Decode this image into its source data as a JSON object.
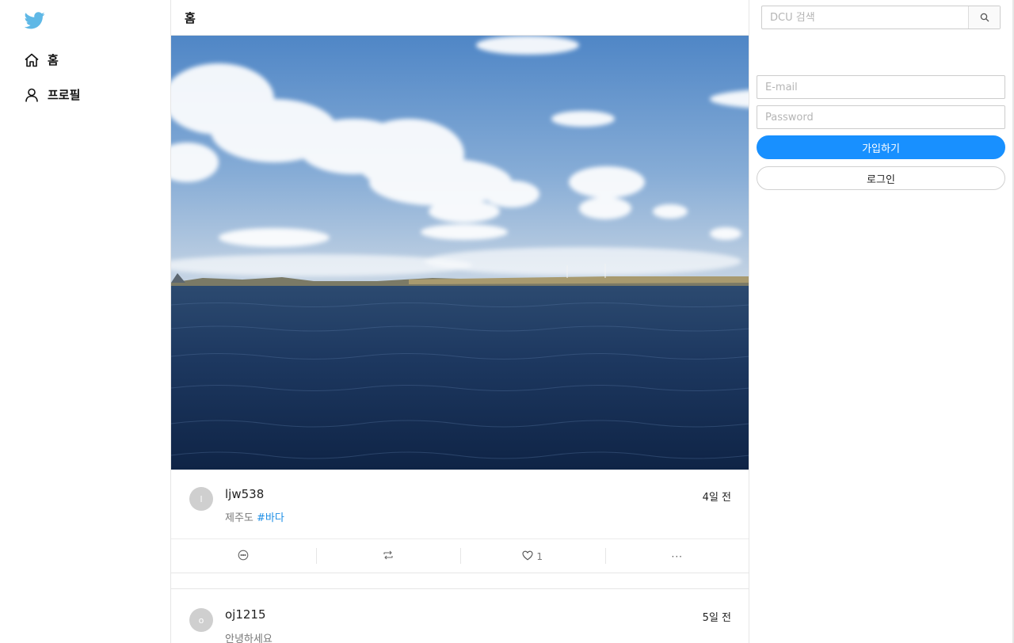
{
  "colors": {
    "brand": "#1d9bf0",
    "accent": "#1890ff",
    "hashtag": "#1d8ee6",
    "border": "#e6e6e6"
  },
  "sidebar": {
    "logo_icon": "bird-icon",
    "items": [
      {
        "label": "홈",
        "icon": "home-icon"
      },
      {
        "label": "프로필",
        "icon": "user-icon"
      }
    ]
  },
  "main": {
    "title": "홈",
    "posts": [
      {
        "avatar_letter": "l",
        "username": "ljw538",
        "time": "4일 전",
        "text": "제주도 ",
        "hashtag": "#바다",
        "actions": {
          "comment_icon": "comment-icon",
          "retweet_icon": "retweet-icon",
          "like_icon": "heart-icon",
          "like_count": "1",
          "more_icon": "more-icon",
          "more_label": "···"
        }
      },
      {
        "avatar_letter": "o",
        "username": "oj1215",
        "time": "5일 전",
        "text": "안녕하세요"
      }
    ]
  },
  "right": {
    "search": {
      "placeholder": "DCU 검색",
      "icon": "search-icon"
    },
    "email_placeholder": "E-mail",
    "password_placeholder": "Password",
    "signup_label": "가입하기",
    "login_label": "로그인"
  }
}
